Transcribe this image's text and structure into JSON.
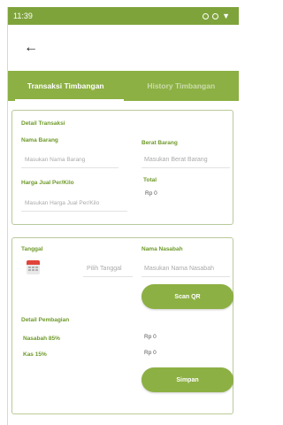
{
  "status_bar": {
    "time": "11:39"
  },
  "tabs": [
    {
      "label": "Transaksi Timbangan",
      "active": true
    },
    {
      "label": "History Timbangan",
      "active": false
    }
  ],
  "detail_transaksi": {
    "section_title": "Detail Transaksi",
    "nama_barang_label": "Nama Barang",
    "nama_barang_placeholder": "Masukan Nama Barang",
    "berat_barang_label": "Berat Barang",
    "berat_barang_placeholder": "Masukan Berat Barang",
    "harga_label": "Harga Jual Per/Kilo",
    "harga_placeholder": "Masukan Harga Jual Per/Kilo",
    "total_label": "Total",
    "total_value": "Rp 0"
  },
  "detail_nasabah": {
    "tanggal_label": "Tanggal",
    "tanggal_placeholder": "Pilih Tanggal",
    "nama_nasabah_label": "Nama Nasabah",
    "nama_nasabah_placeholder": "Masukan Nama Nasabah",
    "scan_button": "Scan QR",
    "pembagian_title": "Detail Pembagian",
    "nasabah_share_label": "Nasabah 85%",
    "nasabah_share_value": "Rp 0",
    "kas_label": "Kas 15%",
    "kas_value": "Rp 0",
    "save_button": "Simpan"
  },
  "colors": {
    "primary": "#8cb043",
    "label_green": "#6e9a2a",
    "status_bar": "#7fa33b"
  }
}
